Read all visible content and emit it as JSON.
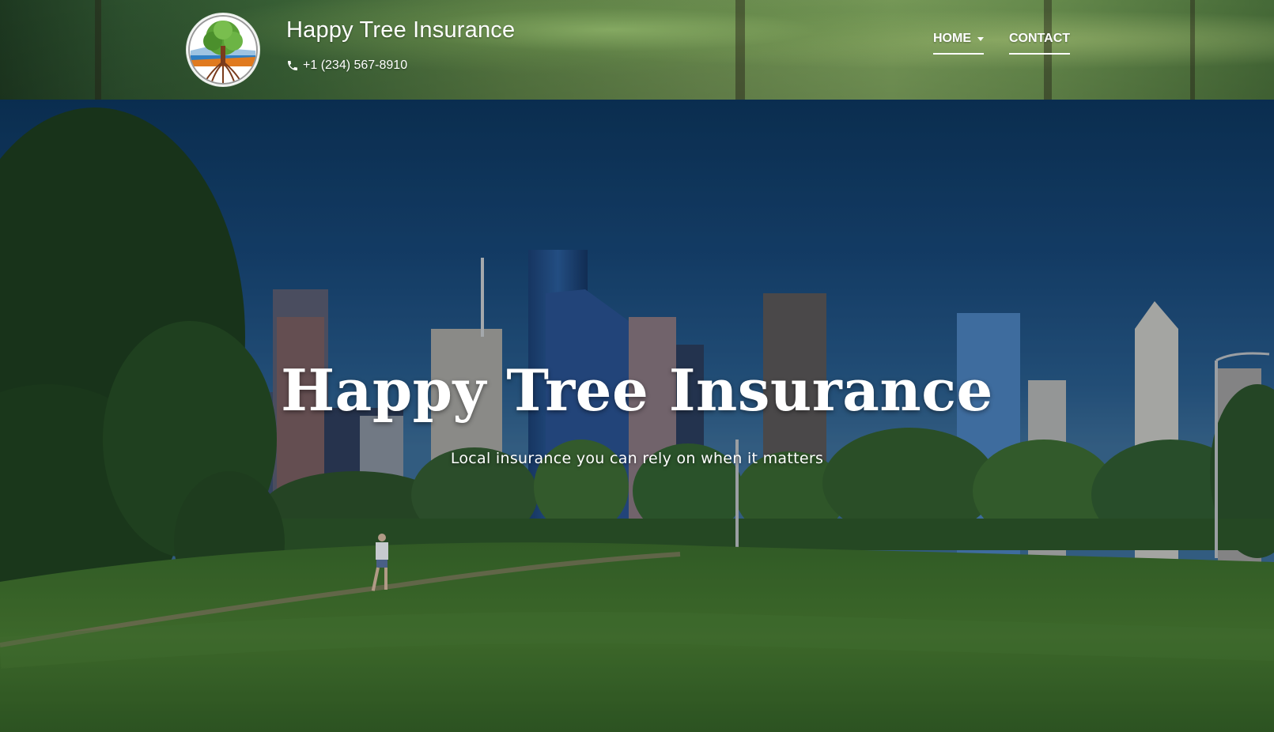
{
  "header": {
    "brand_name": "Happy Tree Insurance",
    "phone": "+1 (234) 567-8910",
    "logo_icon": "happy-tree-logo",
    "phone_icon": "phone-icon"
  },
  "nav": {
    "items": [
      {
        "label": "HOME",
        "has_dropdown": true
      },
      {
        "label": "CONTACT",
        "has_dropdown": false
      }
    ]
  },
  "hero": {
    "title": "Happy Tree Insurance",
    "subtitle": "Local insurance you can rely on when it matters"
  },
  "colors": {
    "text": "#ffffff",
    "sky_top": "#0d3357",
    "grass": "#3f6b26"
  }
}
